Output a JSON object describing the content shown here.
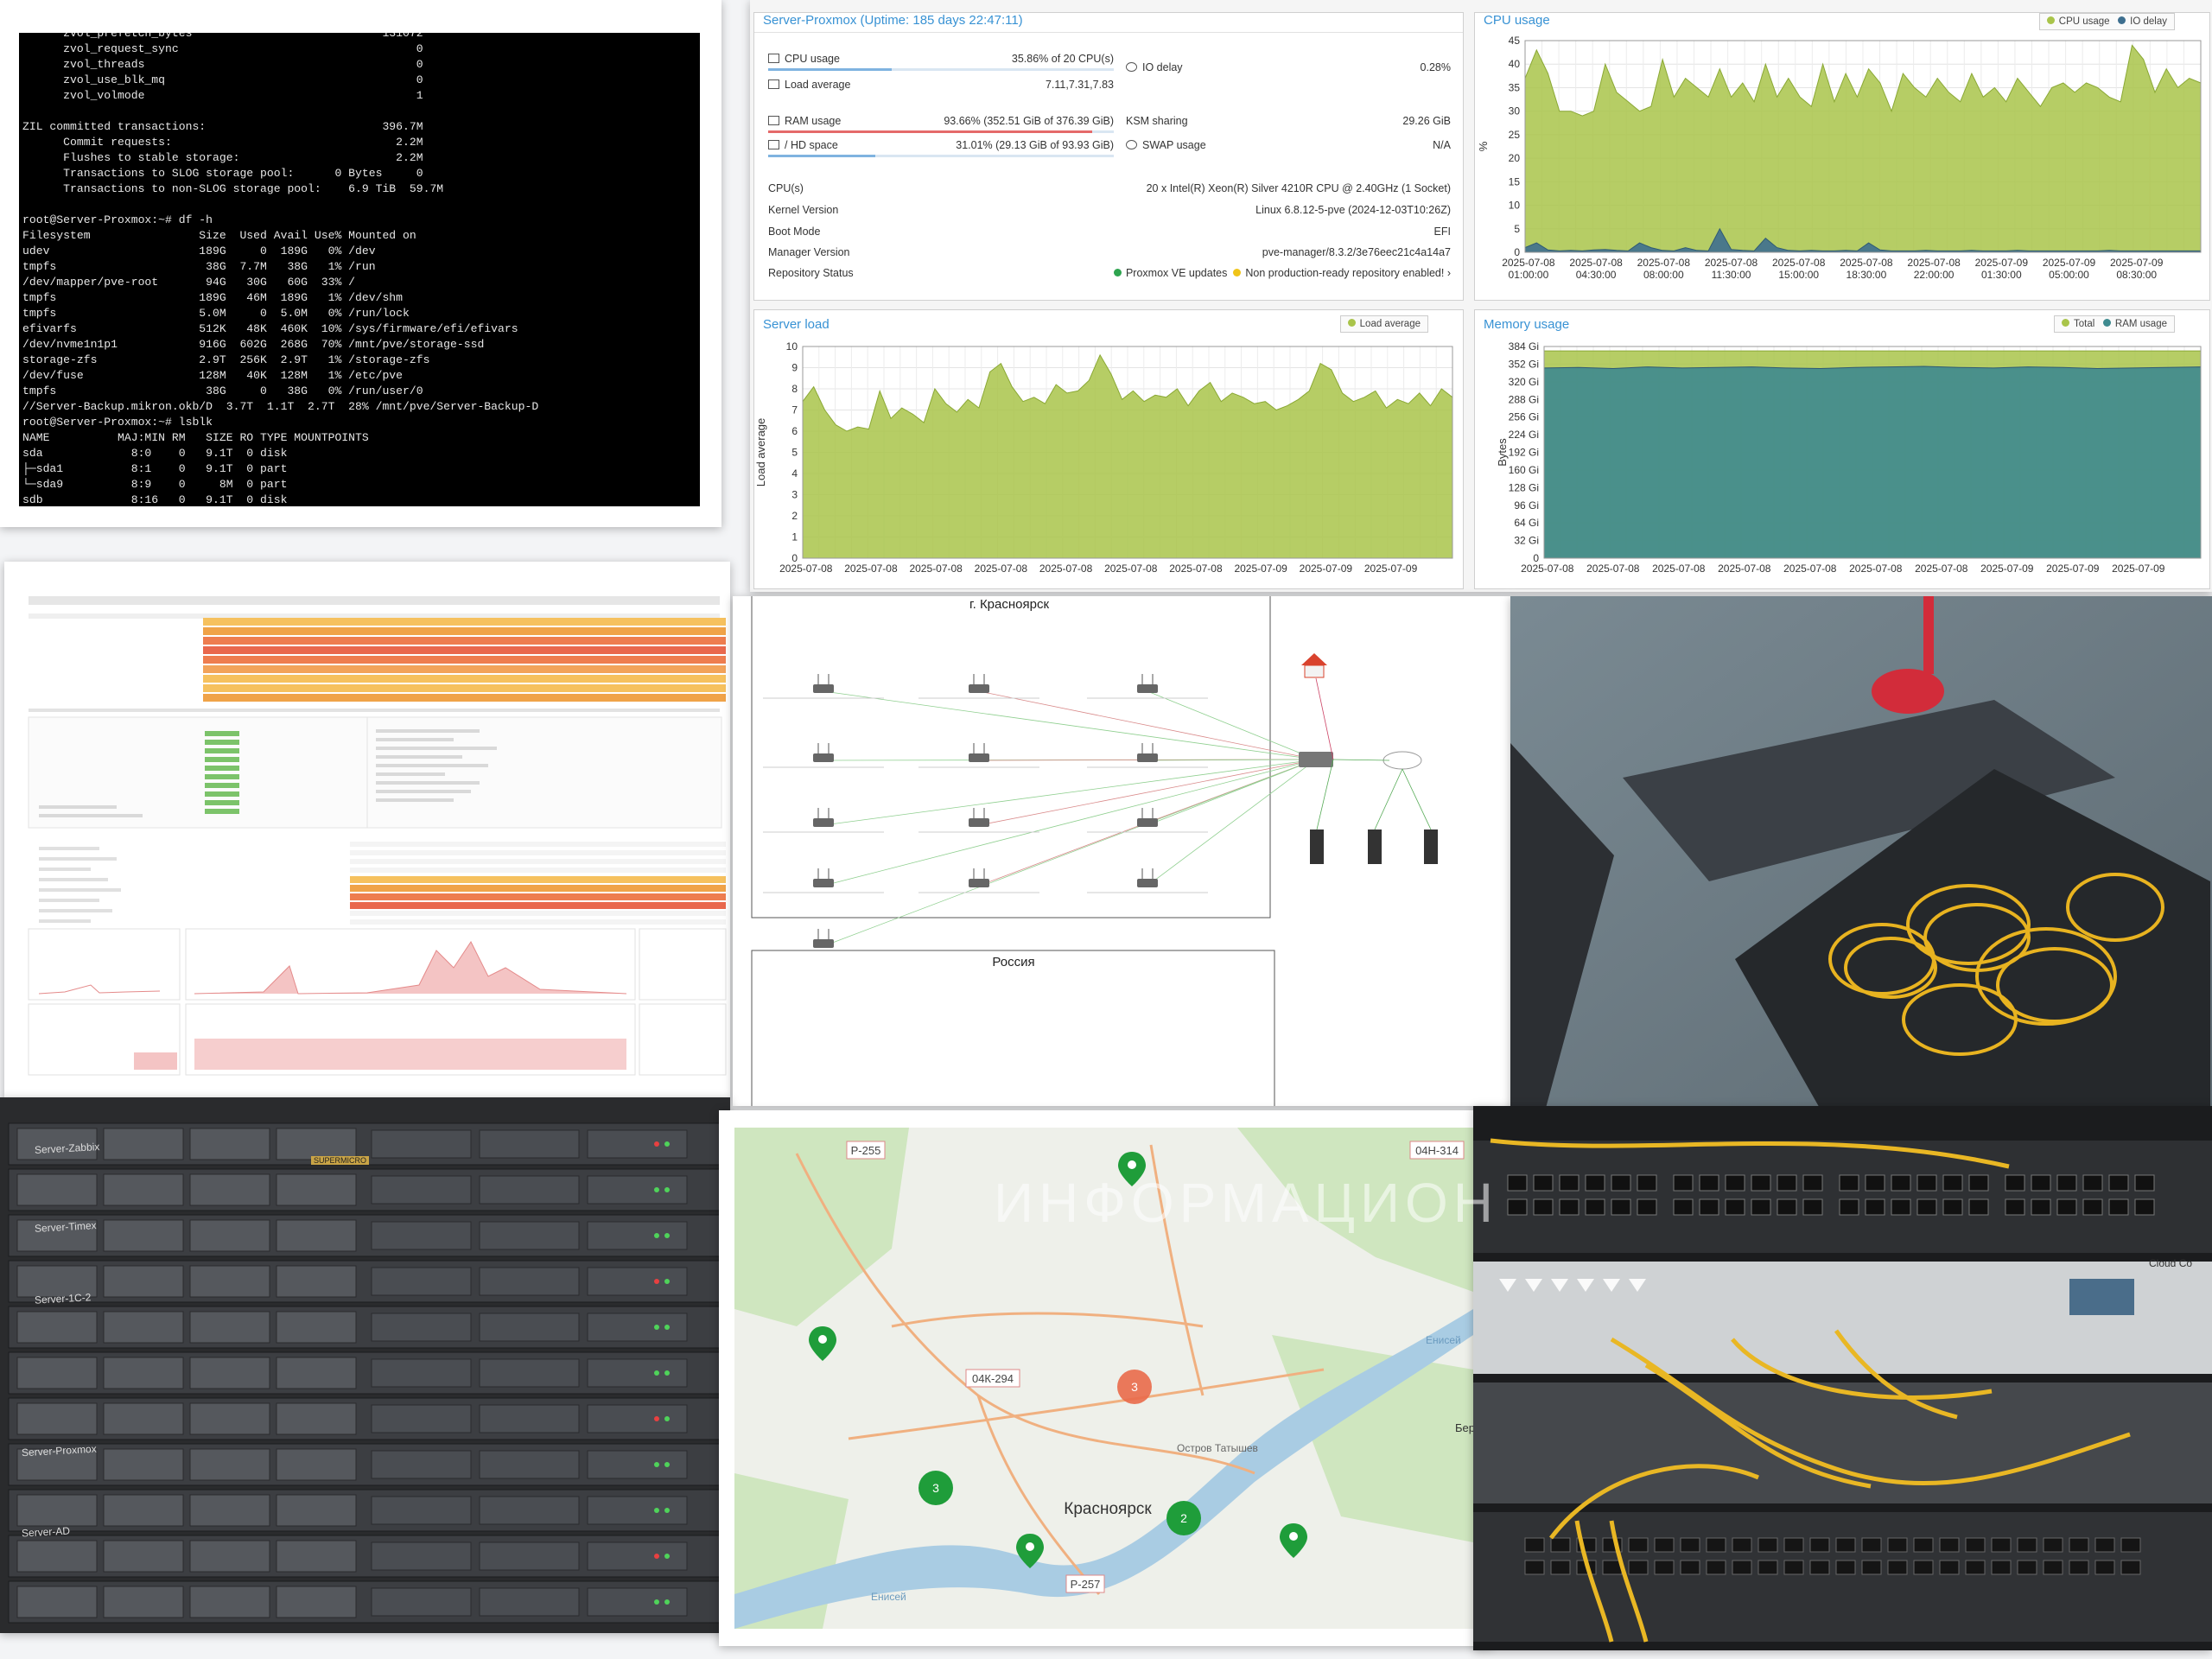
{
  "terminal": {
    "lines": [
      "      zvol_prefetch_bytes                            131072",
      "      zvol_request_sync                                   0",
      "      zvol_threads                                        0",
      "      zvol_use_blk_mq                                     0",
      "      zvol_volmode                                        1",
      "",
      "ZIL committed transactions:                          396.7M",
      "      Commit requests:                                 2.2M",
      "      Flushes to stable storage:                       2.2M",
      "      Transactions to SLOG storage pool:      0 Bytes     0",
      "      Transactions to non-SLOG storage pool:    6.9 TiB  59.7M",
      "",
      "root@Server-Proxmox:~# df -h",
      "Filesystem                Size  Used Avail Use% Mounted on",
      "udev                      189G     0  189G   0% /dev",
      "tmpfs                      38G  7.7M   38G   1% /run",
      "/dev/mapper/pve-root       94G   30G   60G  33% /",
      "tmpfs                     189G   46M  189G   1% /dev/shm",
      "tmpfs                     5.0M     0  5.0M   0% /run/lock",
      "efivarfs                  512K   48K  460K  10% /sys/firmware/efi/efivars",
      "/dev/nvme1n1p1            916G  602G  268G  70% /mnt/pve/storage-ssd",
      "storage-zfs               2.9T  256K  2.9T   1% /storage-zfs",
      "/dev/fuse                 128M   40K  128M   1% /etc/pve",
      "tmpfs                      38G     0   38G   0% /run/user/0",
      "//Server-Backup.mikron.okb/D  3.7T  1.1T  2.7T  28% /mnt/pve/Server-Backup-D",
      "root@Server-Proxmox:~# lsblk",
      "NAME          MAJ:MIN RM   SIZE RO TYPE MOUNTPOINTS",
      "sda             8:0    0   9.1T  0 disk",
      "├─sda1          8:1    0   9.1T  0 part",
      "└─sda9          8:9    0     8M  0 part",
      "sdb             8:16   0   9.1T  0 disk"
    ]
  },
  "proxmox": {
    "status_title": "Server-Proxmox (Uptime: 185 days 22:47:11)",
    "cpu_label": "CPU usage",
    "cpu_value": "35.86% of 20 CPU(s)",
    "cpu_pct": 35.86,
    "io_label": "IO delay",
    "io_value": "0.28%",
    "load_label": "Load average",
    "load_value": "7.11,7.31,7.83",
    "ram_label": "RAM usage",
    "ram_value": "93.66% (352.51 GiB of 376.39 GiB)",
    "ram_pct": 93.66,
    "ksm_label": "KSM sharing",
    "ksm_value": "29.26 GiB",
    "hd_label": "/ HD space",
    "hd_value": "31.01% (29.13 GiB of 93.93 GiB)",
    "hd_pct": 31.01,
    "swap_label": "SWAP usage",
    "swap_value": "N/A",
    "cpus_label": "CPU(s)",
    "cpus_value": "20 x Intel(R) Xeon(R) Silver 4210R CPU @ 2.40GHz (1 Socket)",
    "kernel_label": "Kernel Version",
    "kernel_value": "Linux 6.8.12-5-pve (2024-12-03T10:26Z)",
    "boot_label": "Boot Mode",
    "boot_value": "EFI",
    "manager_label": "Manager Version",
    "manager_value": "pve-manager/8.3.2/3e76eec21c4a14a7",
    "repo_label": "Repository Status",
    "repo_ok": "Proxmox VE updates",
    "repo_warn": "Non production-ready repository enabled!",
    "cpu_chart_title": "CPU usage",
    "cpu_legend_1": "CPU usage",
    "cpu_legend_2": "IO delay",
    "load_chart_title": "Server load",
    "load_legend": "Load average",
    "mem_chart_title": "Memory usage",
    "mem_legend_1": "Total",
    "mem_legend_2": "RAM usage",
    "colors": {
      "accent": "#3892d4",
      "cpu": "#a9c44a",
      "io": "#3e6f8f",
      "mem_total": "#a9c44a",
      "mem_ram": "#3e8a8f"
    }
  },
  "chart_data": [
    {
      "type": "area",
      "title": "CPU usage",
      "ylabel": "%",
      "ylim": [
        0,
        45
      ],
      "yticks": [
        0,
        5,
        10,
        15,
        20,
        25,
        30,
        35,
        40,
        45
      ],
      "xticks": [
        "2025-07-08 01:00:00",
        "2025-07-08 04:30:00",
        "2025-07-08 08:00:00",
        "2025-07-08 11:30:00",
        "2025-07-08 15:00:00",
        "2025-07-08 18:30:00",
        "2025-07-08 22:00:00",
        "2025-07-09 01:30:00",
        "2025-07-09 05:00:00",
        "2025-07-09 08:30:00"
      ],
      "series": [
        {
          "name": "CPU usage",
          "values": [
            37,
            43,
            38,
            30,
            30,
            29,
            30,
            40,
            34,
            32,
            30,
            31,
            41,
            33,
            37,
            35,
            33,
            39,
            33,
            36,
            32,
            40,
            33,
            37,
            33,
            31,
            40,
            32,
            38,
            33,
            39,
            36,
            30,
            38,
            35,
            33,
            37,
            34,
            32,
            38,
            33,
            35,
            32,
            37,
            34,
            31,
            35,
            36,
            34,
            36,
            35,
            33,
            32,
            44,
            41,
            34,
            39,
            35,
            37,
            36
          ]
        },
        {
          "name": "IO delay",
          "values": [
            1,
            2,
            0.5,
            0.3,
            0.4,
            0.3,
            0.5,
            0.6,
            0.4,
            0.3,
            2,
            1,
            0.4,
            0.3,
            1,
            0.4,
            0.3,
            5,
            0.6,
            0.4,
            0.3,
            3,
            1,
            0.4,
            0.3,
            0.4,
            0.3,
            0.3,
            0.4,
            0.3,
            2,
            0.5,
            0.3,
            0.3,
            0.3,
            0.4,
            0.3,
            0.3,
            0.3,
            0.4,
            0.3,
            0.3,
            0.3,
            0.4,
            0.3,
            0.3,
            0.3,
            0.3,
            0.3,
            0.3,
            0.3,
            0.4,
            0.3,
            0.3,
            0.3,
            0.3,
            0.3,
            0.3,
            0.3,
            0.3
          ]
        }
      ]
    },
    {
      "type": "area",
      "title": "Server load",
      "ylabel": "Load average",
      "ylim": [
        0,
        10
      ],
      "yticks": [
        0,
        1,
        2,
        3,
        4,
        5,
        6,
        7,
        8,
        9,
        10
      ],
      "xticks": [
        "2025-07-08",
        "2025-07-08",
        "2025-07-08",
        "2025-07-08",
        "2025-07-08",
        "2025-07-08",
        "2025-07-08",
        "2025-07-09",
        "2025-07-09",
        "2025-07-09"
      ],
      "series": [
        {
          "name": "Load average",
          "values": [
            7.4,
            8.1,
            7.0,
            6.3,
            6.0,
            6.2,
            6.1,
            7.9,
            6.6,
            7.1,
            6.8,
            6.4,
            8.0,
            7.3,
            6.9,
            7.5,
            7.1,
            8.8,
            9.2,
            8.1,
            7.4,
            7.6,
            7.3,
            8.2,
            7.8,
            7.9,
            8.4,
            9.6,
            8.7,
            7.5,
            7.9,
            7.4,
            7.7,
            7.6,
            8.0,
            7.2,
            7.9,
            8.3,
            7.4,
            7.8,
            7.6,
            7.3,
            7.4,
            7.0,
            7.2,
            7.5,
            7.9,
            9.2,
            8.9,
            7.8,
            7.4,
            7.6,
            7.9,
            7.1,
            7.5,
            7.3,
            7.8,
            7.2,
            8.0,
            7.6
          ]
        }
      ]
    },
    {
      "type": "area",
      "title": "Memory usage",
      "ylabel": "Bytes",
      "ylim": [
        0,
        384
      ],
      "yticks": [
        "0",
        "32 Gi",
        "64 Gi",
        "96 Gi",
        "128 Gi",
        "160 Gi",
        "192 Gi",
        "224 Gi",
        "256 Gi",
        "288 Gi",
        "320 Gi",
        "352 Gi",
        "384 Gi"
      ],
      "xticks": [
        "2025-07-08",
        "2025-07-08",
        "2025-07-08",
        "2025-07-08",
        "2025-07-08",
        "2025-07-08",
        "2025-07-08",
        "2025-07-09",
        "2025-07-09",
        "2025-07-09"
      ],
      "series": [
        {
          "name": "Total",
          "values": [
            376,
            376,
            376,
            376,
            376,
            376,
            376,
            376,
            376,
            376,
            376,
            376,
            376,
            376,
            376,
            376,
            376,
            376,
            376,
            376
          ]
        },
        {
          "name": "RAM usage",
          "values": [
            345,
            346,
            344,
            347,
            345,
            346,
            347,
            345,
            344,
            346,
            347,
            348,
            346,
            345,
            347,
            346,
            344,
            345,
            346,
            347
          ]
        }
      ]
    }
  ],
  "topology": {
    "city_title": "г. Красноярск",
    "country_title": "Россия"
  },
  "map": {
    "road_1": "Р-255",
    "road_2": "04Н-314",
    "road_3": "04К-294",
    "road_4": "Р-257",
    "city": "Красноярск",
    "island": "Остров Татышев",
    "river": "Енисей",
    "river_2": "Енисей",
    "edge": "Бер",
    "cluster_red": "3",
    "cluster_green_1": "3",
    "cluster_green_2": "2",
    "colors": {
      "marker": "#1f9d3a",
      "cluster_red": "#e96a4a"
    }
  },
  "photos": {
    "server_labels": [
      "Server-Zabbix",
      "Server-Timex",
      "Server-1C-2",
      "Server-Proxmox",
      "Server-AD"
    ],
    "brand": "SUPERMICRO",
    "rack_brand": "Cloud Co"
  },
  "watermark": "ИНФОРМАЦИОН"
}
